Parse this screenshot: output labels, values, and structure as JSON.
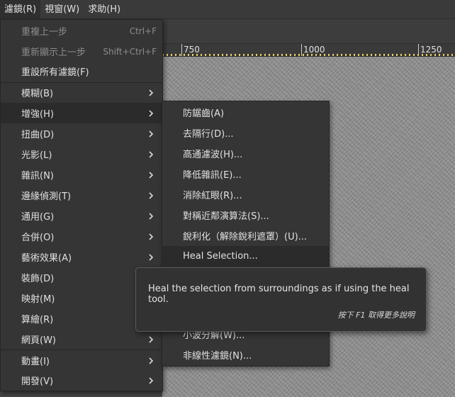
{
  "menubar": {
    "items": [
      {
        "label": "濾鏡(R)",
        "active": true
      },
      {
        "label": "視窗(W)",
        "active": false
      },
      {
        "label": "求助(H)",
        "active": false
      }
    ]
  },
  "ruler": {
    "labels": [
      "750",
      "1000",
      "1250"
    ]
  },
  "filters_menu": {
    "items": [
      {
        "label": "重複上一步",
        "shortcut": "Ctrl+F",
        "disabled": true
      },
      {
        "label": "重新顯示上一步",
        "shortcut": "Shift+Ctrl+F",
        "disabled": true
      },
      {
        "label": "重設所有濾鏡(F)"
      },
      {
        "label": "模糊(B)",
        "submenu": true
      },
      {
        "label": "增強(H)",
        "submenu": true,
        "highlighted": true
      },
      {
        "label": "扭曲(D)",
        "submenu": true
      },
      {
        "label": "光影(L)",
        "submenu": true
      },
      {
        "label": "雜訊(N)",
        "submenu": true
      },
      {
        "label": "邊緣偵測(T)",
        "submenu": true
      },
      {
        "label": "通用(G)",
        "submenu": true
      },
      {
        "label": "合併(O)",
        "submenu": true
      },
      {
        "label": "藝術效果(A)",
        "submenu": true
      },
      {
        "label": "裝飾(D)",
        "submenu": true
      },
      {
        "label": "映射(M)",
        "submenu": true
      },
      {
        "label": "算繪(R)",
        "submenu": true
      },
      {
        "label": "網頁(W)",
        "submenu": true
      },
      {
        "label": "動畫(I)",
        "submenu": true
      },
      {
        "label": "開發(V)",
        "submenu": true
      }
    ]
  },
  "enhance_menu": {
    "items": [
      {
        "label": "防鋸齒(A)"
      },
      {
        "label": "去隔行(D)..."
      },
      {
        "label": "高通濾波(H)..."
      },
      {
        "label": "降低雜訊(E)..."
      },
      {
        "label": "消除紅眼(R)..."
      },
      {
        "label": "對稱近鄰演算法(S)..."
      },
      {
        "label": "銳利化（解除銳利遮罩）(U)..."
      },
      {
        "label": "Heal Selection...",
        "highlighted": true
      },
      {
        "label": "小波分解(W)..."
      },
      {
        "label": "非線性濾鏡(N)..."
      }
    ]
  },
  "tooltip": {
    "text": "Heal the selection from surroundings as if using the heal tool.",
    "help": "按下 F1 取得更多說明"
  }
}
